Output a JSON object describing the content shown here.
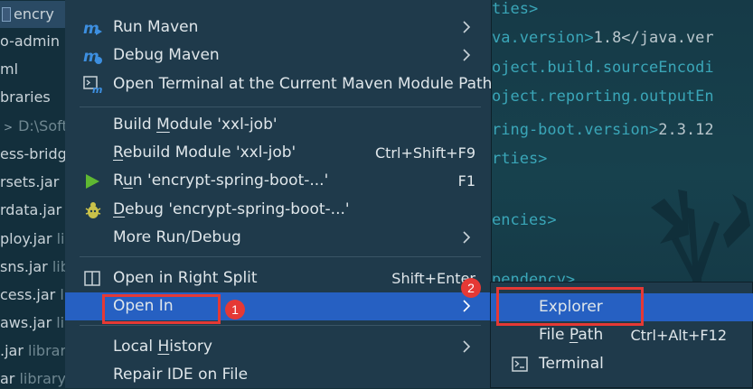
{
  "project_tree": {
    "items": [
      {
        "label": "encry",
        "extra": ""
      },
      {
        "label": "o-admin",
        "extra": ""
      },
      {
        "label": "ml",
        "extra": ""
      },
      {
        "label": "braries",
        "extra": ""
      },
      {
        "label": "D:\\Soft",
        "extra": ""
      },
      {
        "label": "ess-bridg",
        "extra": ""
      },
      {
        "label": "rsets.jar",
        "extra": ""
      },
      {
        "label": "rdata.jar",
        "extra": ""
      },
      {
        "label": "ploy.jar",
        "extra": "li"
      },
      {
        "label": "sns.jar",
        "extra": "lib"
      },
      {
        "label": "cess.jar",
        "extra": "lib"
      },
      {
        "label": "aws.jar",
        "extra": "li"
      },
      {
        "label": ".jar",
        "extra": "librar"
      },
      {
        "label": "ar",
        "extra": "library"
      }
    ]
  },
  "editor": {
    "lines": [
      {
        "tag": "ties>",
        "value": ""
      },
      {
        "tag": "va.version>",
        "value": "1.8</java.ver"
      },
      {
        "tag": "oject.build.sourceEncodi",
        "value": ""
      },
      {
        "tag": "oject.reporting.outputEn",
        "value": ""
      },
      {
        "tag": "ring-boot.version>",
        "value": "2.3.12"
      },
      {
        "tag": "rties>",
        "value": ""
      },
      {
        "tag": "",
        "value": ""
      },
      {
        "tag": "encies>",
        "value": ""
      },
      {
        "tag": "",
        "value": ""
      },
      {
        "tag": "pendency>",
        "value": ""
      }
    ]
  },
  "menu": {
    "run_maven": "Run Maven",
    "debug_maven": "Debug Maven",
    "open_terminal": "Open Terminal at the Current Maven Module Path",
    "build_module_pre": "Build ",
    "build_module_u": "M",
    "build_module_post": "odule 'xxl-job'",
    "rebuild_pre": "R",
    "rebuild_post": "ebuild Module 'xxl-job'",
    "rebuild_shortcut": "Ctrl+Shift+F9",
    "run_pre": "R",
    "run_u": "u",
    "run_post": "n 'encrypt-spring-boot-...'",
    "run_shortcut": "F1",
    "debug_u": "D",
    "debug_post": "ebug 'encrypt-spring-boot-...'",
    "more_run_debug": "More Run/Debug",
    "open_right_split": "Open in Right Split",
    "open_right_split_shortcut": "Shift+Enter",
    "open_in": "Open In",
    "local_history_pre": "Local ",
    "local_history_u": "H",
    "local_history_post": "istory",
    "repair_ide": "Repair IDE on File"
  },
  "submenu": {
    "explorer": "Explorer",
    "file_path_pre": "File ",
    "file_path_u": "P",
    "file_path_post": "ath",
    "file_path_shortcut": "Ctrl+Alt+F12",
    "terminal": "Terminal"
  },
  "annotations": {
    "badge_1": "1",
    "badge_2": "2"
  },
  "colors": {
    "menu_bg": "#1f3a4b",
    "highlight": "#2660c2",
    "annotation_red": "#e53935",
    "maven_blue": "#3d8fe0",
    "run_green": "#5fb832",
    "debug_yellow": "#c9c14a"
  }
}
